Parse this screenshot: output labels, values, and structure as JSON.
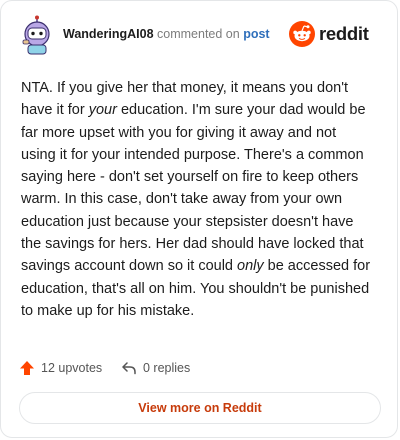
{
  "author": {
    "username": "WanderingAI08",
    "commented_on_text": "commented on",
    "post_link_text": "post"
  },
  "brand": {
    "logo_text": "reddit",
    "accent_color": "#ff4500"
  },
  "comment": {
    "segments": [
      {
        "text": "NTA. If you give her that money, it means you don't have it for "
      },
      {
        "text": "your",
        "emphasis": true
      },
      {
        "text": " education. I'm sure your dad would be far more upset with you for giving it away and not using it for your intended purpose. There's a common saying here - don't set yourself on fire to keep others warm. In this case, don't take away from your own education just because your stepsister doesn't have the savings for hers. Her dad should have locked that savings account down so it could "
      },
      {
        "text": "only",
        "emphasis": true
      },
      {
        "text": " be accessed for education, that's all on him. You shouldn't be punished to make up for his mistake."
      }
    ]
  },
  "actions": {
    "upvotes_label": "12 upvotes",
    "replies_label": "0 replies"
  },
  "footer": {
    "button_label": "View more on Reddit",
    "button_color": "#c73b0b"
  }
}
